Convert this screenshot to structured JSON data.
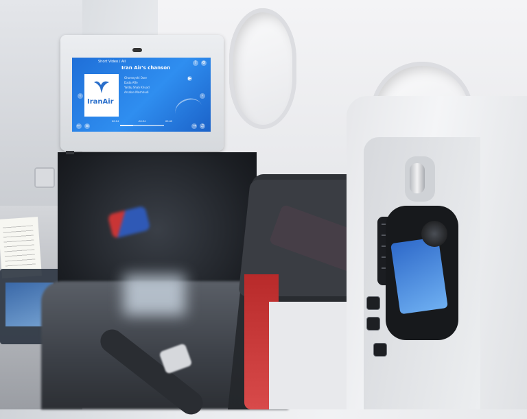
{
  "ife": {
    "breadcrumb": "Short Video  /  All",
    "title": "Iran Air's chanson",
    "logo_text": "IranAir",
    "list_items": [
      "Ghomeyshi Ozer",
      "Dada Affe",
      "Yaldaj Shab Khuad",
      "Arsalan Mashhudi"
    ],
    "time_start": "00:14",
    "time_mid": "-00:34",
    "time_end": "00:49",
    "progress": 0.3,
    "icons": {
      "help": "question-icon",
      "settings": "gear-icon",
      "play": "play-icon",
      "prev": "chevron-left-icon",
      "next": "chevron-right-icon",
      "back": "back-icon",
      "menu": "menu-icon",
      "forward": "forward-icon",
      "volume": "volume-icon"
    },
    "colors": {
      "screen_blue": "#1f6fd8",
      "logo_blue": "#2a6fcb",
      "console_red": "#c93535"
    }
  }
}
